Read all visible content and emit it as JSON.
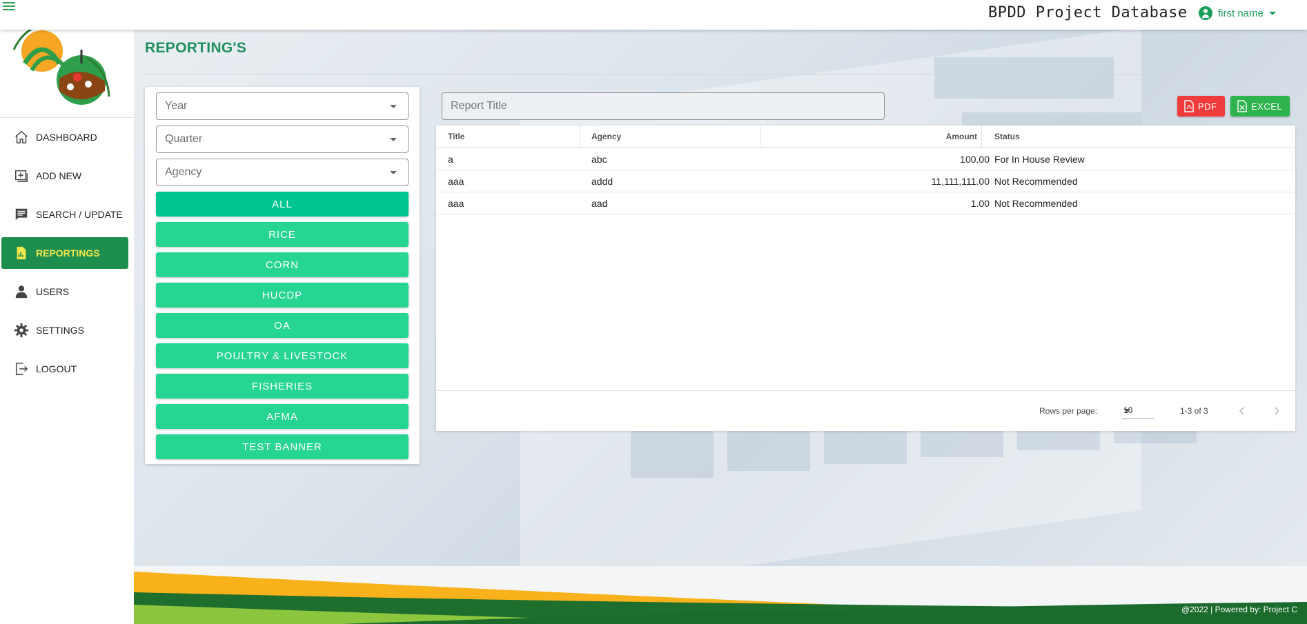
{
  "header": {
    "app_title": "BPDD Project Database",
    "user_name": "first name"
  },
  "sidebar": {
    "items": [
      {
        "label": "DASHBOARD",
        "icon": "home-icon"
      },
      {
        "label": "ADD NEW",
        "icon": "add-box-icon"
      },
      {
        "label": "SEARCH / UPDATE",
        "icon": "message-icon"
      },
      {
        "label": "REPORTINGS",
        "icon": "file-chart-icon",
        "active": true
      },
      {
        "label": "USERS",
        "icon": "user-icon"
      },
      {
        "label": "SETTINGS",
        "icon": "gear-icon"
      },
      {
        "label": "LOGOUT",
        "icon": "logout-icon"
      }
    ]
  },
  "page": {
    "title": "REPORTING'S"
  },
  "filters": {
    "year_placeholder": "Year",
    "quarter_placeholder": "Quarter",
    "agency_placeholder": "Agency",
    "categories": [
      "ALL",
      "RICE",
      "CORN",
      "HUCDP",
      "OA",
      "POULTRY & LIVESTOCK",
      "FISHERIES",
      "AFMA",
      "TEST BANNER"
    ]
  },
  "search": {
    "placeholder": "Report Title"
  },
  "export": {
    "pdf_label": "PDF",
    "excel_label": "EXCEL",
    "pdf_color": "#ef3b3b",
    "excel_color": "#2eb34d"
  },
  "table": {
    "headers": {
      "title": "Title",
      "agency": "Agency",
      "amount": "Amount",
      "status": "Status"
    },
    "rows": [
      {
        "title": "a",
        "agency": "abc",
        "amount": "100.00",
        "status": "For In House Review"
      },
      {
        "title": "aaa",
        "agency": "addd",
        "amount": "11,111,111.00",
        "status": "Not Recommended"
      },
      {
        "title": "aaa",
        "agency": "aad",
        "amount": "1.00",
        "status": "Not Recommended"
      }
    ],
    "pagination": {
      "rows_per_page_label": "Rows per page:",
      "rows_per_page": "10",
      "range": "1-3 of 3"
    }
  },
  "footer": {
    "text": "@2022 | Powered by: Project C"
  },
  "colors": {
    "accent_green": "#1e8e4e",
    "category_button": "#26d592",
    "active_nav_text": "#f3e64c"
  }
}
